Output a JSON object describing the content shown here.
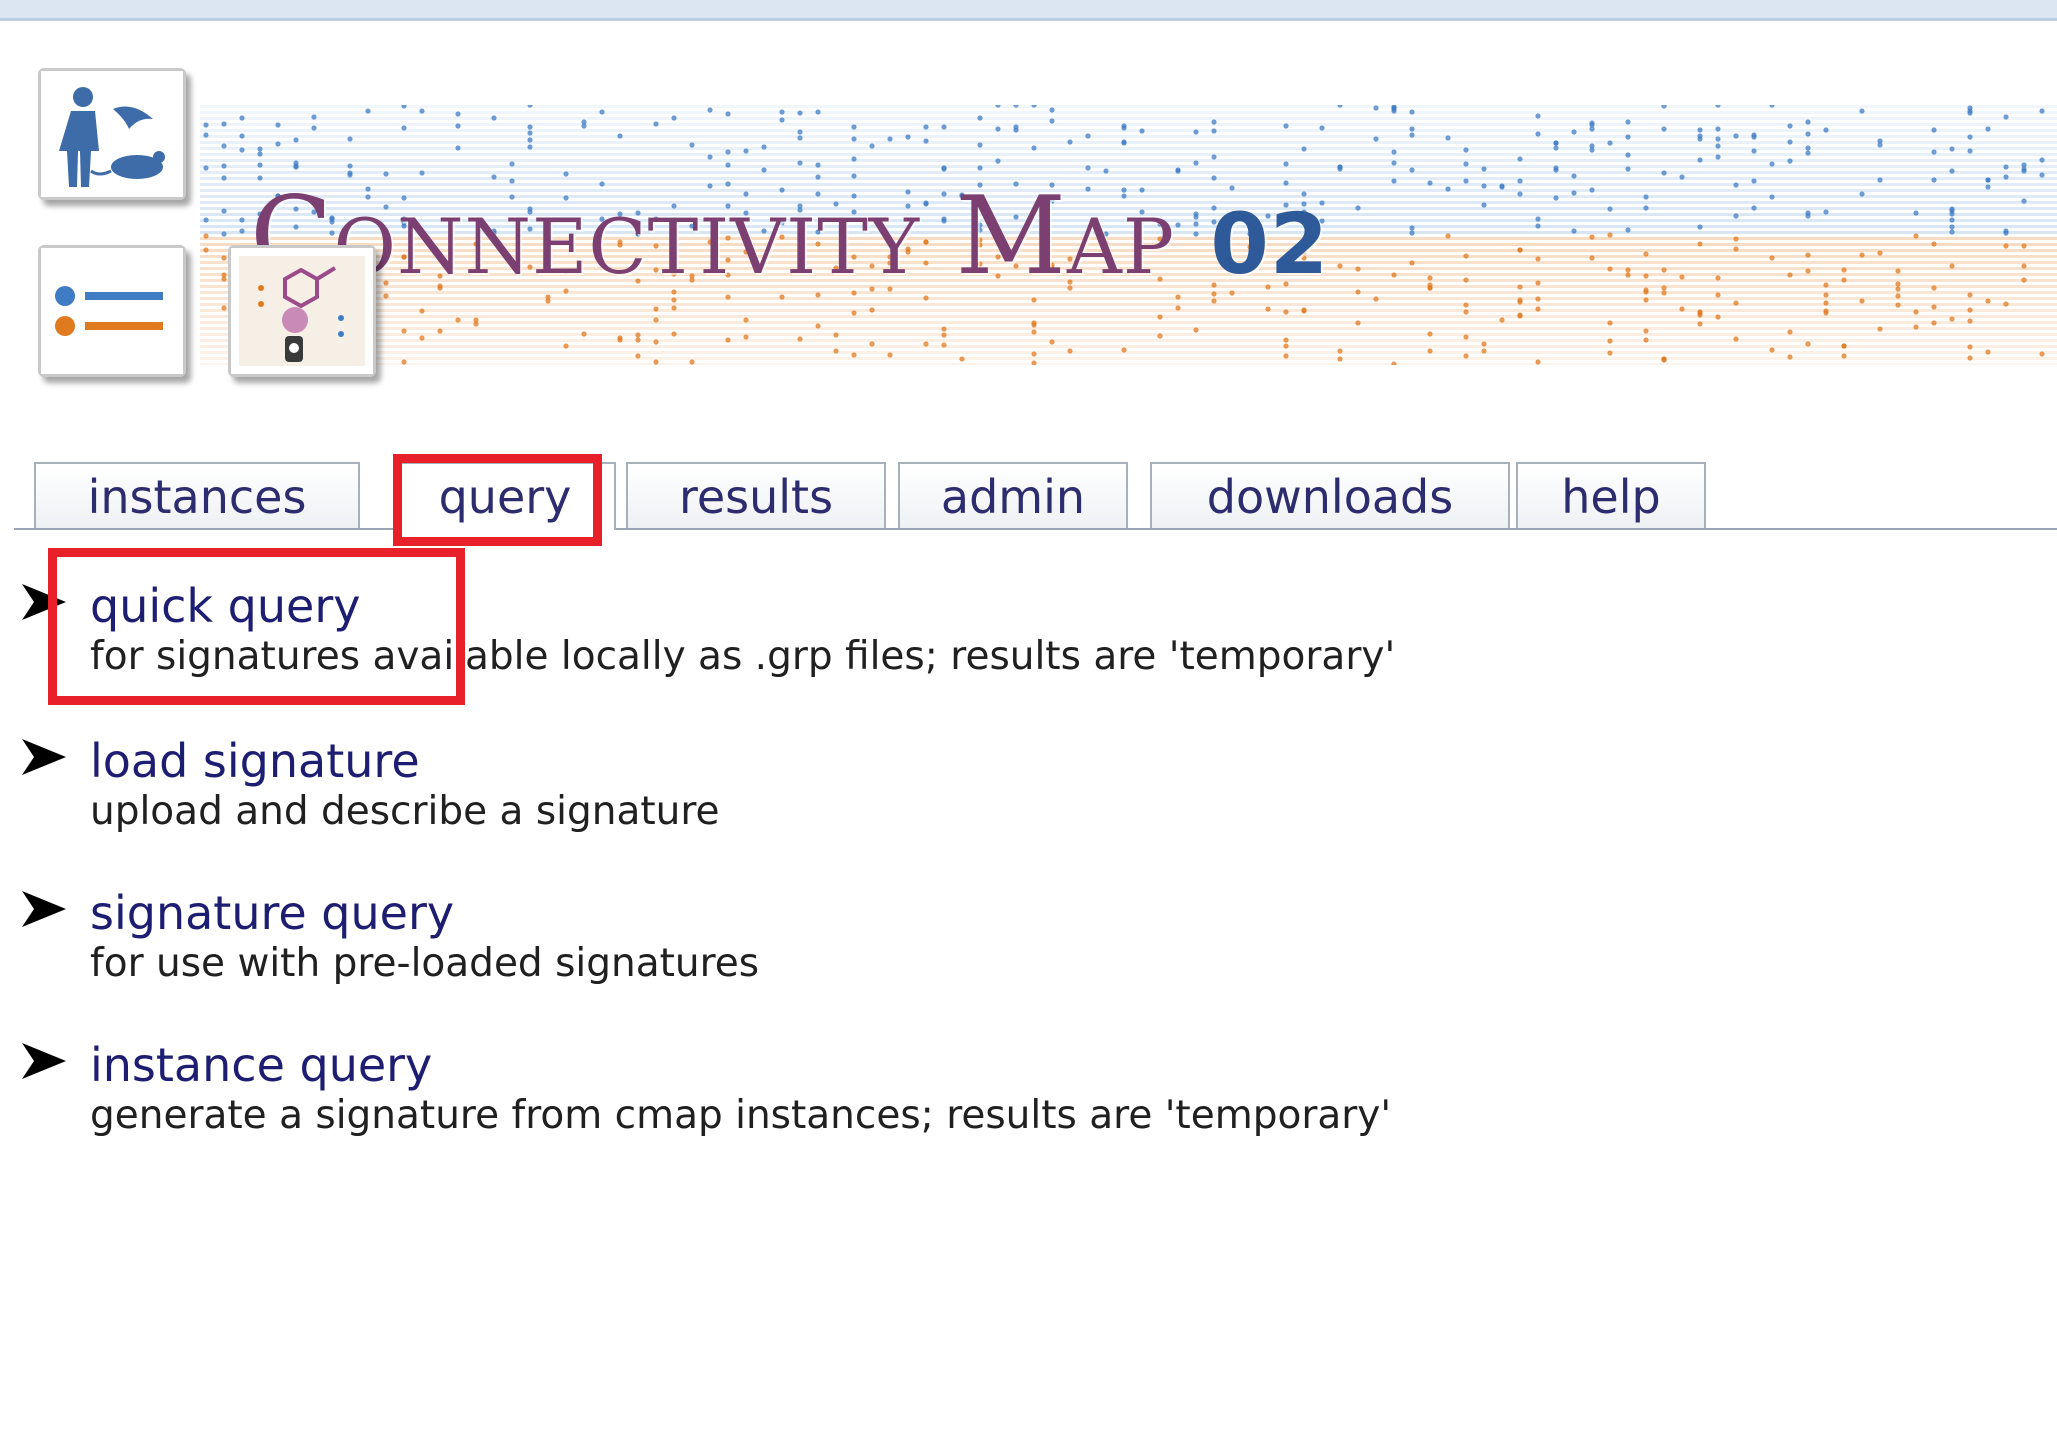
{
  "header": {
    "title": "Connectivity Map",
    "version": "02",
    "logos": [
      "organisms-icon",
      "list-icon",
      "chemical-icon"
    ]
  },
  "tabs": [
    {
      "label": "instances",
      "active": false
    },
    {
      "label": "query",
      "active": true
    },
    {
      "label": "results",
      "active": false
    },
    {
      "label": "admin",
      "active": false
    },
    {
      "label": "downloads",
      "active": false
    },
    {
      "label": "help",
      "active": false
    }
  ],
  "menu": [
    {
      "title": "quick query",
      "description": "for signatures available locally as .grp files; results are 'temporary'"
    },
    {
      "title": "load signature",
      "description": "upload and describe a signature"
    },
    {
      "title": "signature query",
      "description": "for use with pre-loaded signatures"
    },
    {
      "title": "instance query",
      "description": "generate a signature from cmap instances; results are 'temporary'"
    }
  ],
  "colors": {
    "highlight": "#e8202a",
    "title": "#7b3f72",
    "version": "#2f5a9a",
    "link": "#1d1d72",
    "accent_orange": "#e07a1f",
    "accent_blue": "#3f7cc4"
  }
}
